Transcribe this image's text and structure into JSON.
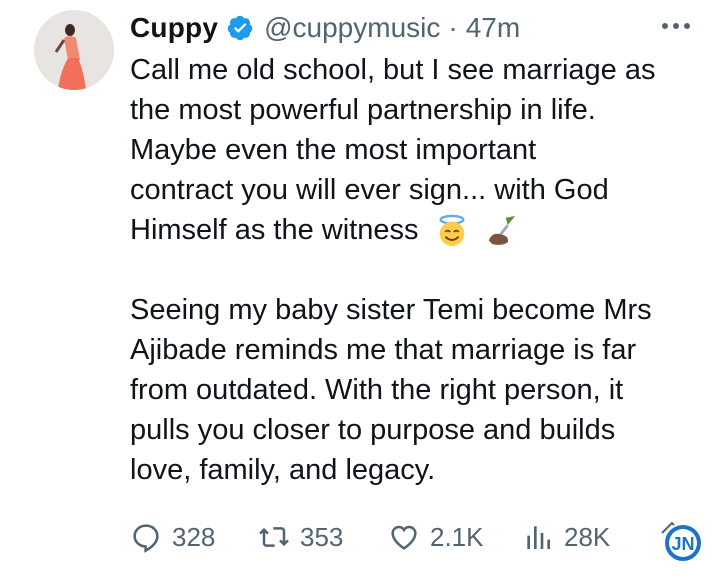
{
  "tweet": {
    "author_name": "Cuppy",
    "handle": "@cuppymusic",
    "separator": "·",
    "time": "47m",
    "lines": [
      "Call me old school, but I see marriage as",
      "the most powerful partnership in life.",
      "Maybe even the most important",
      "contract you will ever sign... with God",
      "Himself as the witness"
    ],
    "lines2": [
      "Seeing my baby sister Temi become Mrs",
      "Ajibade reminds me that marriage is far",
      "from outdated. With the right person, it",
      "pulls you closer to purpose and builds",
      "love, family, and legacy."
    ],
    "emojis": [
      "smiling-face-with-halo",
      "writing-hand"
    ]
  },
  "actions": {
    "replies": "328",
    "reposts": "353",
    "likes": "2.1K",
    "views": "28K"
  },
  "watermark": {
    "text": "JN"
  },
  "colors": {
    "text": "#0f1419",
    "secondary": "#536471",
    "verified": "#1d9bf0",
    "watermark": "#1d73c9"
  }
}
